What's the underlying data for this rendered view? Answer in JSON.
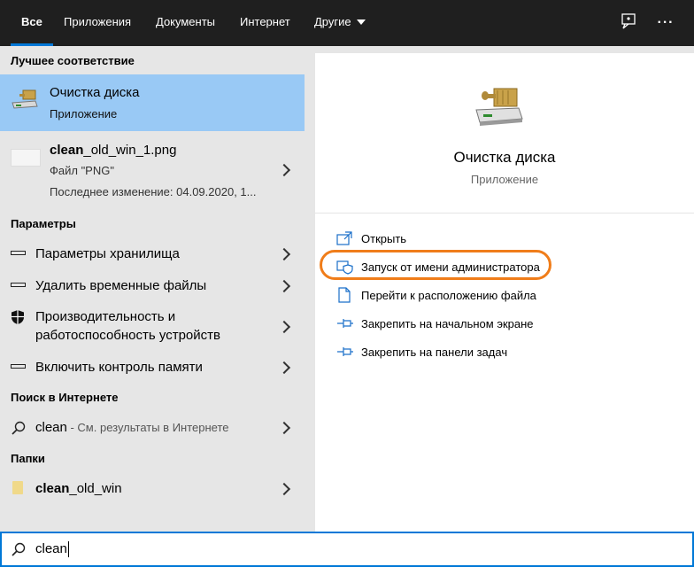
{
  "tabs": [
    {
      "label": "Все",
      "active": true
    },
    {
      "label": "Приложения"
    },
    {
      "label": "Документы"
    },
    {
      "label": "Интернет"
    },
    {
      "label": "Другие"
    }
  ],
  "top_icons": [
    "feedback-icon",
    "more-options-icon"
  ],
  "more_glyph": "···",
  "left": {
    "best_match_header": "Лучшее соответствие",
    "best_match": {
      "title": "Очистка диска",
      "subtitle": "Приложение"
    },
    "file_result": {
      "title_bold": "clean",
      "title_rest": "_old_win_1.png",
      "type": "Файл \"PNG\"",
      "modified": "Последнее изменение: 04.09.2020, 1..."
    },
    "settings_header": "Параметры",
    "settings": [
      {
        "label": "Параметры хранилища",
        "icon": "storage-icon"
      },
      {
        "label": "Удалить временные файлы",
        "icon": "storage-icon"
      },
      {
        "label_line1": "Производительность и",
        "label_line2": "работоспособность устройств",
        "icon": "shield-icon"
      },
      {
        "label": "Включить контроль памяти",
        "icon": "storage-icon"
      }
    ],
    "web_header": "Поиск в Интернете",
    "web_result": {
      "query": "clean",
      "suffix": " - См. результаты в Интернете"
    },
    "folders_header": "Папки",
    "folder": {
      "bold": "clean",
      "rest": "_old_win"
    }
  },
  "right": {
    "app_title": "Очистка диска",
    "app_type": "Приложение",
    "actions": [
      {
        "label": "Открыть",
        "icon": "open-icon"
      },
      {
        "label": "Запуск от имени администратора",
        "icon": "admin-shield-icon",
        "highlighted": true
      },
      {
        "label": "Перейти к расположению файла",
        "icon": "file-location-icon"
      },
      {
        "label": "Закрепить на начальном экране",
        "icon": "pin-icon"
      },
      {
        "label": "Закрепить на панели задач",
        "icon": "pin-icon"
      }
    ]
  },
  "search": {
    "value": "clean"
  },
  "colors": {
    "accent": "#0078d7",
    "highlight": "#99c9f5",
    "annotation": "#f07d1a"
  }
}
